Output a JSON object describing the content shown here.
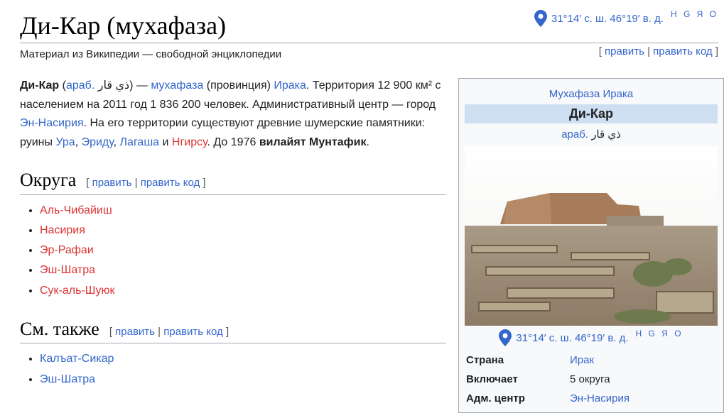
{
  "title": "Ди-Кар (мухафаза)",
  "coords": {
    "text": "31°14′ с. ш. 46°19′ в. д.",
    "langs": "H G Я O"
  },
  "tagline": "Материал из Википедии — свободной энциклопедии",
  "edit": {
    "edit": "править",
    "edit_code": "править код",
    "sep": "|",
    "open": "[",
    "close": "]"
  },
  "intro": {
    "t1": "Ди-Кар",
    "t2": " (",
    "t3": "араб.",
    "t4": " ذي قار) — ",
    "t5": "мухафаза",
    "t6": " (провинция) ",
    "t7": "Ирака",
    "t8": ". Территория 12 900 км² с населением на 2011 год 1 836 200 человек. Административный центр — город ",
    "t9": "Эн-Насирия",
    "t10": ". На его территории существуют древние шумерские памятники: руины ",
    "t11": "Ура",
    "t12": ", ",
    "t13": "Эриду",
    "t14": ", ",
    "t15": "Лагаша",
    "t16": " и ",
    "t17": "Нгирсу",
    "t18": ". До 1976 ",
    "t19": "вилайят Мунтафик",
    "t20": "."
  },
  "sections": [
    {
      "heading": "Округа",
      "items": [
        "Аль-Чибайиш",
        "Насирия",
        "Эр-Рафаи",
        "Эш-Шатра",
        "Сук-аль-Шуюк"
      ]
    },
    {
      "heading": "См. также",
      "items": [
        "Калъат-Сикар",
        "Эш-Шатра"
      ]
    }
  ],
  "infobox": {
    "caption": "Мухафаза Ирака",
    "name": "Ди-Кар",
    "native_prefix": "араб.",
    "native": " ذي قار",
    "rows": [
      {
        "key": "Страна",
        "value": "Ирак"
      },
      {
        "key": "Включает",
        "value": "5 округа"
      },
      {
        "key": "Адм. центр",
        "value": "Эн-Насирия"
      }
    ]
  },
  "colors": {
    "link": "#3366cc",
    "redlink": "#d33",
    "infobox_header": "#cedff2"
  }
}
